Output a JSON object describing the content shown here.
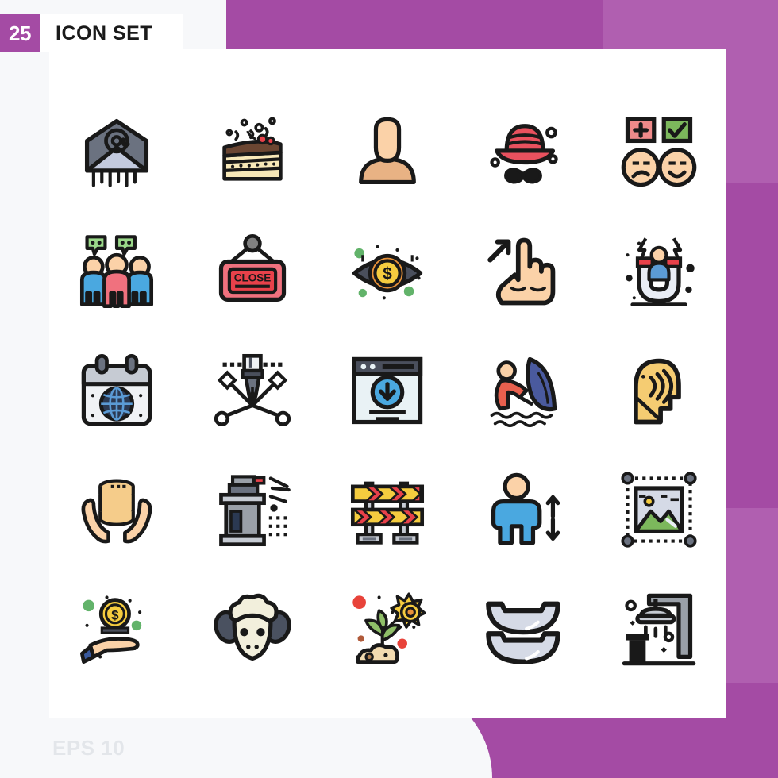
{
  "header": {
    "count_badge": "25",
    "title": "ICON SET",
    "badge_color": "#a44ba4"
  },
  "footer": {
    "format_label": "EPS 10"
  },
  "theme": {
    "accent": "#a44ba4",
    "accent_light": "#b05fb0",
    "card_background": "#ffffff",
    "page_background": "#f7f8fa",
    "stroke": "#191919"
  },
  "grid": {
    "columns": 5,
    "rows": 5,
    "total_icons": 25,
    "icons": [
      {
        "position": 1,
        "name": "email-envelope-at-icon",
        "label": "Email"
      },
      {
        "position": 2,
        "name": "cake-slice-icon",
        "label": "Cake"
      },
      {
        "position": 3,
        "name": "user-avatar-icon",
        "label": "Avatar"
      },
      {
        "position": 4,
        "name": "hat-mustache-icon",
        "label": "Gentleman"
      },
      {
        "position": 5,
        "name": "feedback-rating-faces-icon",
        "label": "Feedback"
      },
      {
        "position": 6,
        "name": "group-chat-people-icon",
        "label": "Team Chat"
      },
      {
        "position": 7,
        "name": "close-sign-icon",
        "label": "Close Sign",
        "text": "CLOSE"
      },
      {
        "position": 8,
        "name": "eye-dollar-vision-icon",
        "label": "Vision"
      },
      {
        "position": 9,
        "name": "hand-pointer-resize-icon",
        "label": "Drag"
      },
      {
        "position": 10,
        "name": "magnet-customer-icon",
        "label": "Attraction"
      },
      {
        "position": 11,
        "name": "calendar-globe-icon",
        "label": "Global Event"
      },
      {
        "position": 12,
        "name": "pen-tool-anchor-icon",
        "label": "Pen Tool"
      },
      {
        "position": 13,
        "name": "browser-download-icon",
        "label": "Download"
      },
      {
        "position": 14,
        "name": "surfing-person-icon",
        "label": "Surfing"
      },
      {
        "position": 15,
        "name": "head-sound-waves-icon",
        "label": "Hearing"
      },
      {
        "position": 16,
        "name": "hands-coins-stack-icon",
        "label": "Savings"
      },
      {
        "position": 17,
        "name": "spray-machine-icon",
        "label": "Sprayer"
      },
      {
        "position": 18,
        "name": "road-barrier-icon",
        "label": "Barrier"
      },
      {
        "position": 19,
        "name": "person-height-arrows-icon",
        "label": "Height"
      },
      {
        "position": 20,
        "name": "image-resize-handles-icon",
        "label": "Resize Image"
      },
      {
        "position": 21,
        "name": "hand-dollar-coin-icon",
        "label": "Payment"
      },
      {
        "position": 22,
        "name": "sheep-face-icon",
        "label": "Sheep"
      },
      {
        "position": 23,
        "name": "plant-growth-sun-icon",
        "label": "Growth"
      },
      {
        "position": 24,
        "name": "bowls-stack-icon",
        "label": "Bowls"
      },
      {
        "position": 25,
        "name": "shower-bathroom-icon",
        "label": "Shower"
      }
    ]
  }
}
